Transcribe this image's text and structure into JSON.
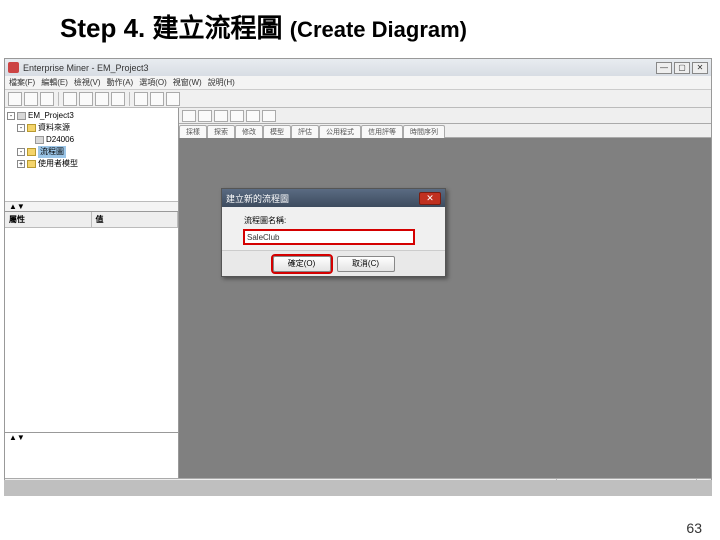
{
  "slide": {
    "prefix": "Step 4.",
    "zh": "建立流程圖",
    "en": "(Create Diagram)",
    "page": "63"
  },
  "titlebar": {
    "text": "Enterprise Miner - EM_Project3"
  },
  "winbtns": {
    "min": "—",
    "max": "▢",
    "close": "✕"
  },
  "menu": {
    "file": "檔案(F)",
    "edit": "編輯(E)",
    "view": "檢視(V)",
    "action": "動作(A)",
    "opt": "選項(O)",
    "win": "視窗(W)",
    "help": "說明(H)"
  },
  "tree": {
    "root": "EM_Project3",
    "n1": "資料來源",
    "n2": "D24006",
    "n3": "流程圖",
    "n4": "使用者模型"
  },
  "prop": {
    "col1": "屬性",
    "col2": "值"
  },
  "tabs": {
    "t0": "採樣",
    "t1": "探索",
    "t2": "修改",
    "t3": "模型",
    "t4": "評估",
    "t5": "公用程式",
    "t6": "信用評等",
    "t7": "時間序列"
  },
  "dialog": {
    "title": "建立新的流程圖",
    "label": "流程圖名稱:",
    "value": "SaleClub",
    "ok": "確定(O)",
    "cancel": "取消(C)",
    "close": "✕"
  }
}
